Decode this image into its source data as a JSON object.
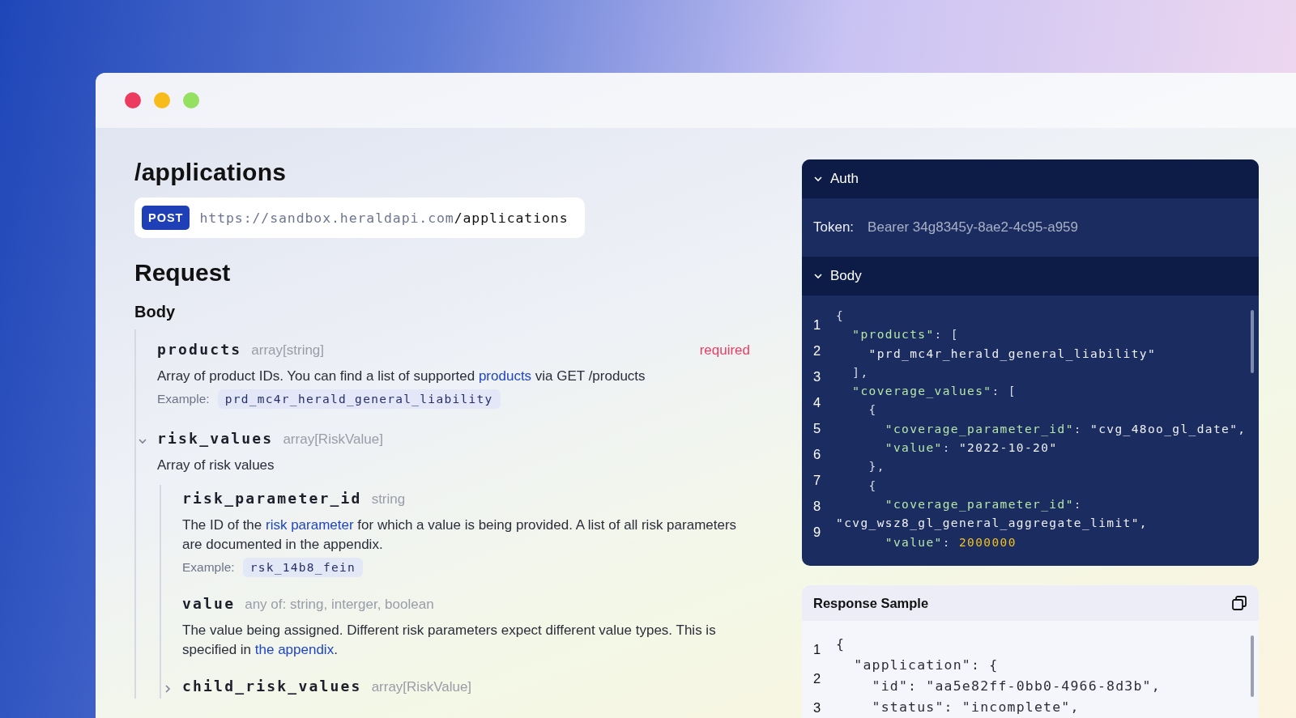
{
  "window": {
    "buttons": [
      {
        "color": "#ec3b5e"
      },
      {
        "color": "#f7bb1c"
      },
      {
        "color": "#94e061"
      }
    ]
  },
  "endpoint": {
    "path": "/applications",
    "method": "POST",
    "base_url": "https://sandbox.heraldapi.com",
    "route": "/applications"
  },
  "request": {
    "title": "Request",
    "body_title": "Body",
    "fields": [
      {
        "name": "products",
        "type": "array[string]",
        "required": "required",
        "description": [
          {
            "text": "Array of product IDs. You can find a list of supported ",
            "link": false
          },
          {
            "text": "products",
            "link": true
          },
          {
            "text": " via GET /products",
            "link": false
          }
        ],
        "example_label": "Example:",
        "example": "prd_mc4r_herald_general_liability"
      },
      {
        "name": "risk_values",
        "type": "array[RiskValue]",
        "expanded": true,
        "description": [
          {
            "text": "Array of risk values",
            "link": false
          }
        ],
        "children": [
          {
            "name": "risk_parameter_id",
            "type": "string",
            "description": [
              {
                "text": "The ID of the ",
                "link": false
              },
              {
                "text": "risk parameter",
                "link": true
              },
              {
                "text": " for which a value is being provided. A list of all risk parameters are documented in the appendix.",
                "link": false
              }
            ],
            "example_label": "Example:",
            "example": "rsk_14b8_fein"
          },
          {
            "name": "value",
            "type": "any of: string, interger, boolean",
            "description": [
              {
                "text": "The value being assigned. Different risk parameters expect different value types. This is specified in ",
                "link": false
              },
              {
                "text": "the appendix",
                "link": true
              },
              {
                "text": ".",
                "link": false
              }
            ]
          },
          {
            "name": "child_risk_values",
            "type": "array[RiskValue]",
            "expanded": false
          }
        ]
      }
    ]
  },
  "auth": {
    "title": "Auth",
    "expanded": true,
    "token_label": "Token:",
    "token": "Bearer 34g8345y-8ae2-4c95-a959"
  },
  "body_panel": {
    "title": "Body",
    "expanded": true,
    "line_numbers": [
      "1",
      "2",
      "3",
      "4",
      "5",
      "6",
      "7",
      "8",
      "9"
    ],
    "code_lines": [
      [
        {
          "kind": "punct",
          "text": "{"
        }
      ],
      [
        {
          "kind": "key",
          "text": "  \"products\""
        },
        {
          "kind": "punct",
          "text": ": ["
        }
      ],
      [
        {
          "kind": "string",
          "text": "    \"prd_mc4r_herald_general_liability\""
        }
      ],
      [
        {
          "kind": "punct",
          "text": "  ],"
        }
      ],
      [
        {
          "kind": "key",
          "text": "  \"coverage_values\""
        },
        {
          "kind": "punct",
          "text": ": ["
        }
      ],
      [
        {
          "kind": "punct",
          "text": "    {"
        }
      ],
      [
        {
          "kind": "key",
          "text": "      \"coverage_parameter_id\""
        },
        {
          "kind": "punct",
          "text": ": "
        },
        {
          "kind": "string",
          "text": "\"cvg_48oo_gl_date\","
        }
      ],
      [
        {
          "kind": "key",
          "text": "      \"value\""
        },
        {
          "kind": "punct",
          "text": ": "
        },
        {
          "kind": "string",
          "text": "\"2022-10-20\""
        }
      ],
      [
        {
          "kind": "punct",
          "text": "    },"
        }
      ],
      [
        {
          "kind": "punct",
          "text": "    {"
        }
      ],
      [
        {
          "kind": "key",
          "text": "      \"coverage_parameter_id\""
        },
        {
          "kind": "punct",
          "text": ":"
        }
      ],
      [
        {
          "kind": "string",
          "text": "\"cvg_wsz8_gl_general_aggregate_limit\","
        }
      ],
      [
        {
          "kind": "key",
          "text": "      \"value\""
        },
        {
          "kind": "punct",
          "text": ": "
        },
        {
          "kind": "number",
          "text": "2000000"
        }
      ]
    ]
  },
  "response": {
    "title": "Response Sample",
    "line_numbers": [
      "1",
      "2",
      "3"
    ],
    "code_lines": [
      "{",
      "  \"application\": {",
      "    \"id\": \"aa5e82ff-0bb0-4966-8d3b\",",
      "    \"status\": \"incomplete\","
    ]
  }
}
